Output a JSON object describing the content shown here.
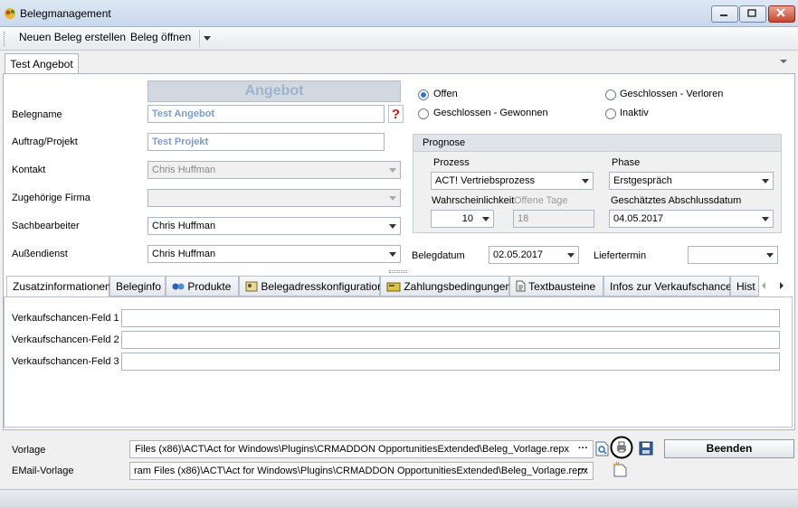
{
  "window": {
    "title": "Belegmanagement"
  },
  "toolbar": {
    "new_label": "Neuen Beleg erstellen",
    "open_label": "Beleg öffnen"
  },
  "doc_tab": {
    "label": "Test Angebot"
  },
  "header": {
    "doc_type": "Angebot"
  },
  "labels": {
    "belegname": "Belegname",
    "auftrag": "Auftrag/Projekt",
    "kontakt": "Kontakt",
    "firma": "Zugehörige Firma",
    "sachbearbeiter": "Sachbearbeiter",
    "aussendienst": "Außendienst",
    "belegdatum": "Belegdatum",
    "liefertermin": "Liefertermin"
  },
  "values": {
    "belegname": "Test Angebot",
    "auftrag": "Test Projekt",
    "kontakt": "Chris Huffman",
    "firma": "",
    "sachbearbeiter": "Chris Huffman",
    "aussendienst": "Chris Huffman",
    "belegdatum": "02.05.2017",
    "liefertermin": ""
  },
  "status": {
    "offen": "Offen",
    "gewonnen": "Geschlossen - Gewonnen",
    "verloren": "Geschlossen - Verloren",
    "inaktiv": "Inaktiv",
    "selected": "offen"
  },
  "prognose": {
    "title": "Prognose",
    "prozess_label": "Prozess",
    "prozess_value": "ACT! Vertriebsprozess",
    "phase_label": "Phase",
    "phase_value": "Erstgespräch",
    "wahrsch_label": "Wahrscheinlichkeit",
    "wahrsch_value": "10",
    "offene_tage_label": "Offene Tage",
    "offene_tage_value": "18",
    "abschluss_label": "Geschätztes Abschlussdatum",
    "abschluss_value": "04.05.2017"
  },
  "tabs": [
    {
      "label": "Zusatzinformationen"
    },
    {
      "label": "Beleginfo"
    },
    {
      "label": "Produkte"
    },
    {
      "label": "Belegadresskonfiguration"
    },
    {
      "label": "Zahlungsbedingungen"
    },
    {
      "label": "Textbausteine"
    },
    {
      "label": "Infos zur Verkaufschance"
    },
    {
      "label": "Hist"
    }
  ],
  "fields": [
    {
      "label": "Verkaufschancen-Feld 1",
      "value": ""
    },
    {
      "label": "Verkaufschancen-Feld 2",
      "value": ""
    },
    {
      "label": "Verkaufschancen-Feld 3",
      "value": ""
    }
  ],
  "bottom": {
    "vorlage_label": "Vorlage",
    "vorlage_value": "Files (x86)\\ACT\\Act for Windows\\Plugins\\CRMADDON OpportunitiesExtended\\Beleg_Vorlage.repx",
    "email_label": "EMail-Vorlage",
    "email_value": "ram Files (x86)\\ACT\\Act for Windows\\Plugins\\CRMADDON OpportunitiesExtended\\Beleg_Vorlage.repx",
    "ellipsis": "···",
    "close_label": "Beenden"
  }
}
